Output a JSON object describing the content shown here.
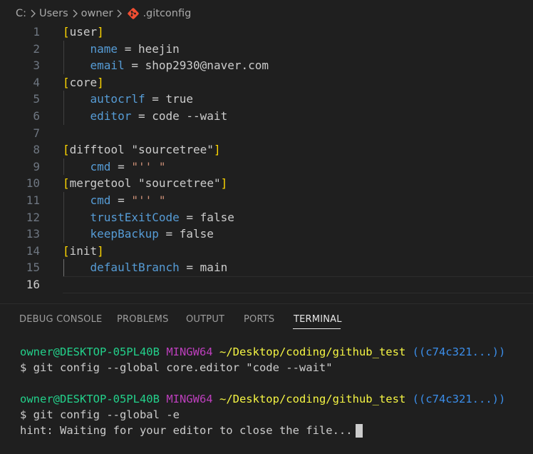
{
  "breadcrumb": {
    "items": [
      "C:",
      "Users",
      "owner",
      ".gitconfig"
    ]
  },
  "editor": {
    "active_line": 16,
    "lines": [
      {
        "n": "1",
        "section": "user"
      },
      {
        "n": "2",
        "key": "name",
        "value": "heejin"
      },
      {
        "n": "3",
        "key": "email",
        "value": "shop2930@naver.com"
      },
      {
        "n": "4",
        "section": "core"
      },
      {
        "n": "5",
        "key": "autocrlf",
        "value": "true"
      },
      {
        "n": "6",
        "key": "editor",
        "value": "code --wait"
      },
      {
        "n": "7"
      },
      {
        "n": "8",
        "section": "difftool",
        "subsection": "\"sourcetree\""
      },
      {
        "n": "9",
        "key": "cmd",
        "string": "\"'' \""
      },
      {
        "n": "10",
        "section": "mergetool",
        "subsection": "\"sourcetree\""
      },
      {
        "n": "11",
        "key": "cmd",
        "string": "\"'' \""
      },
      {
        "n": "12",
        "key": "trustExitCode",
        "value": "false"
      },
      {
        "n": "13",
        "key": "keepBackup",
        "value": "false"
      },
      {
        "n": "14",
        "section": "init"
      },
      {
        "n": "15",
        "key": "defaultBranch",
        "value": "main"
      },
      {
        "n": "16"
      }
    ]
  },
  "panel": {
    "tabs": [
      {
        "label": "DEBUG CONSOLE"
      },
      {
        "label": "PROBLEMS"
      },
      {
        "label": "OUTPUT"
      },
      {
        "label": "PORTS"
      },
      {
        "label": "TERMINAL",
        "active": true
      }
    ]
  },
  "terminal": {
    "prompt1": {
      "user": "owner@DESKTOP-05PL40B",
      "host": "MINGW64",
      "path": "~/Desktop/coding/github_test",
      "branch": "((c74c321...))"
    },
    "cmd1": "$ git config --global core.editor \"code --wait\"",
    "prompt2": {
      "user": "owner@DESKTOP-05PL40B",
      "host": "MINGW64",
      "path": "~/Desktop/coding/github_test",
      "branch": "((c74c321...))"
    },
    "cmd2": "$ git config --global -e",
    "hint": "hint: Waiting for your editor to close the file..."
  },
  "colors": {
    "background": "#1f1f1f",
    "bracket": "#ffd700",
    "key": "#569cd6",
    "string": "#ce9178",
    "term_user": "#23d18b",
    "term_host": "#bc3fbc",
    "term_path": "#f5f543",
    "term_branch": "#3b8eea",
    "git_icon": "#f14e32"
  }
}
